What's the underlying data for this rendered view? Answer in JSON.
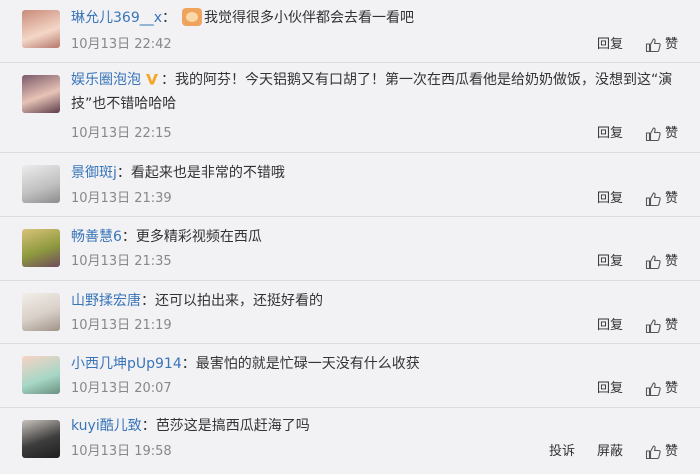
{
  "comments": [
    {
      "username": "琳允儿369__x",
      "sep": "：",
      "text": "我觉得很多小伙伴都会去看一看吧",
      "text_cont": "",
      "time": "10月13日 22:42",
      "reply": "回复",
      "like": "赞",
      "has_emoji": true,
      "verified": false,
      "avatar_colors": [
        "#c98b7a",
        "#f4d7c8"
      ]
    },
    {
      "username": "娱乐圈泡泡",
      "sep": "：",
      "text": "我的阿芬！今天铝鹅又有口胡了！第一次在西瓜看他是给奶奶做饭，没想到这“演",
      "text_cont": "技”也不错哈哈哈",
      "time": "10月13日 22:15",
      "reply": "回复",
      "like": "赞",
      "has_emoji": false,
      "verified": true,
      "avatar_colors": [
        "#7c5a6a",
        "#e7c3b6"
      ]
    },
    {
      "username": "景御斑j",
      "sep": "：",
      "text": "看起来也是非常的不错哦",
      "text_cont": "",
      "time": "10月13日 21:39",
      "reply": "回复",
      "like": "赞",
      "has_emoji": false,
      "verified": false,
      "avatar_colors": [
        "#bfbfbf",
        "#ececec"
      ]
    },
    {
      "username": "畅善慧6",
      "sep": "：",
      "text": "更多精彩视频在西瓜",
      "text_cont": "",
      "time": "10月13日 21:35",
      "reply": "回复",
      "like": "赞",
      "has_emoji": false,
      "verified": false,
      "avatar_colors": [
        "#8f9a3e",
        "#d9c27a"
      ]
    },
    {
      "username": "山野揉宏唐",
      "sep": "：",
      "text": "还可以拍出来，还挺好看的",
      "text_cont": "",
      "time": "10月13日 21:19",
      "reply": "回复",
      "like": "赞",
      "has_emoji": false,
      "verified": false,
      "avatar_colors": [
        "#d8d0c8",
        "#f3eee9"
      ]
    },
    {
      "username": "小西几坤pUp914",
      "sep": "：",
      "text": "最害怕的就是忙碌一天没有什么收获",
      "text_cont": "",
      "time": "10月13日 20:07",
      "reply": "回复",
      "like": "赞",
      "has_emoji": false,
      "verified": false,
      "avatar_colors": [
        "#a6d6c5",
        "#f7d4c6"
      ]
    },
    {
      "username": "kuyi酷儿致",
      "sep": "：",
      "text": "芭莎这是搞西瓜赶海了吗",
      "text_cont": "",
      "time": "10月13日 19:58",
      "reply": "屏蔽",
      "like": "赞",
      "report": "投诉",
      "has_emoji": false,
      "verified": false,
      "avatar_colors": [
        "#3d3d3d",
        "#c9c3bd"
      ]
    }
  ],
  "colors": {
    "username": "#3a75b8",
    "verified_badge": "#f5a623"
  }
}
